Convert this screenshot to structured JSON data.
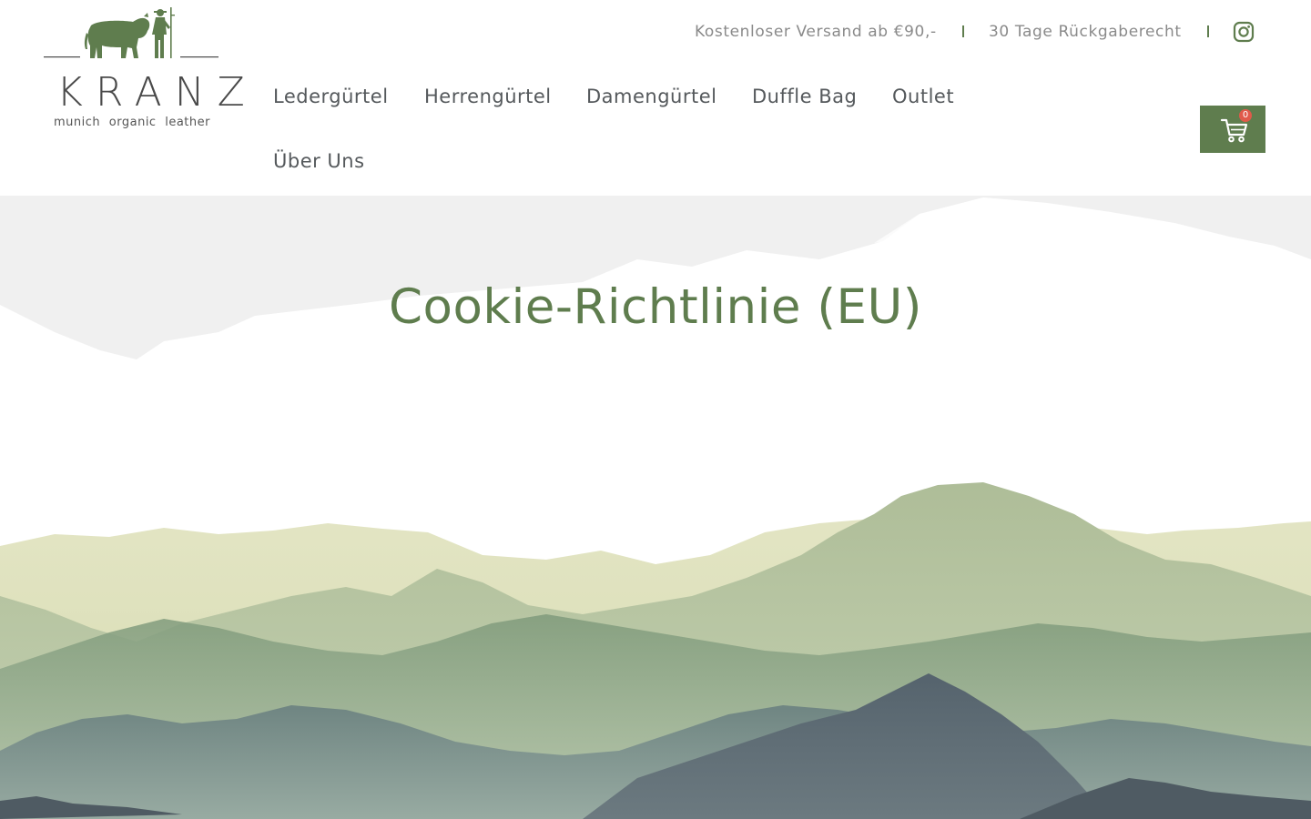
{
  "brand": {
    "name": "KRANZ",
    "tagline": "munich  organic  leather"
  },
  "topbar": {
    "shipping": "Kostenloser Versand ab €90,-",
    "returns": "30 Tage Rückgaberecht",
    "social_icon": "instagram-icon"
  },
  "nav": {
    "items": [
      {
        "label": "Ledergürtel"
      },
      {
        "label": "Herrengürtel"
      },
      {
        "label": "Damengürtel"
      },
      {
        "label": "Duffle Bag"
      },
      {
        "label": "Outlet"
      },
      {
        "label": "Über Uns"
      }
    ]
  },
  "cart": {
    "count": "0",
    "icon": "shopping-cart-icon"
  },
  "hero": {
    "title": "Cookie-Richtlinie (EU)"
  },
  "colors": {
    "brand_green": "#5f7d4e",
    "cart_badge": "#e05a4a",
    "nav_text": "#55595c",
    "topbar_text": "#8a8a8a"
  }
}
